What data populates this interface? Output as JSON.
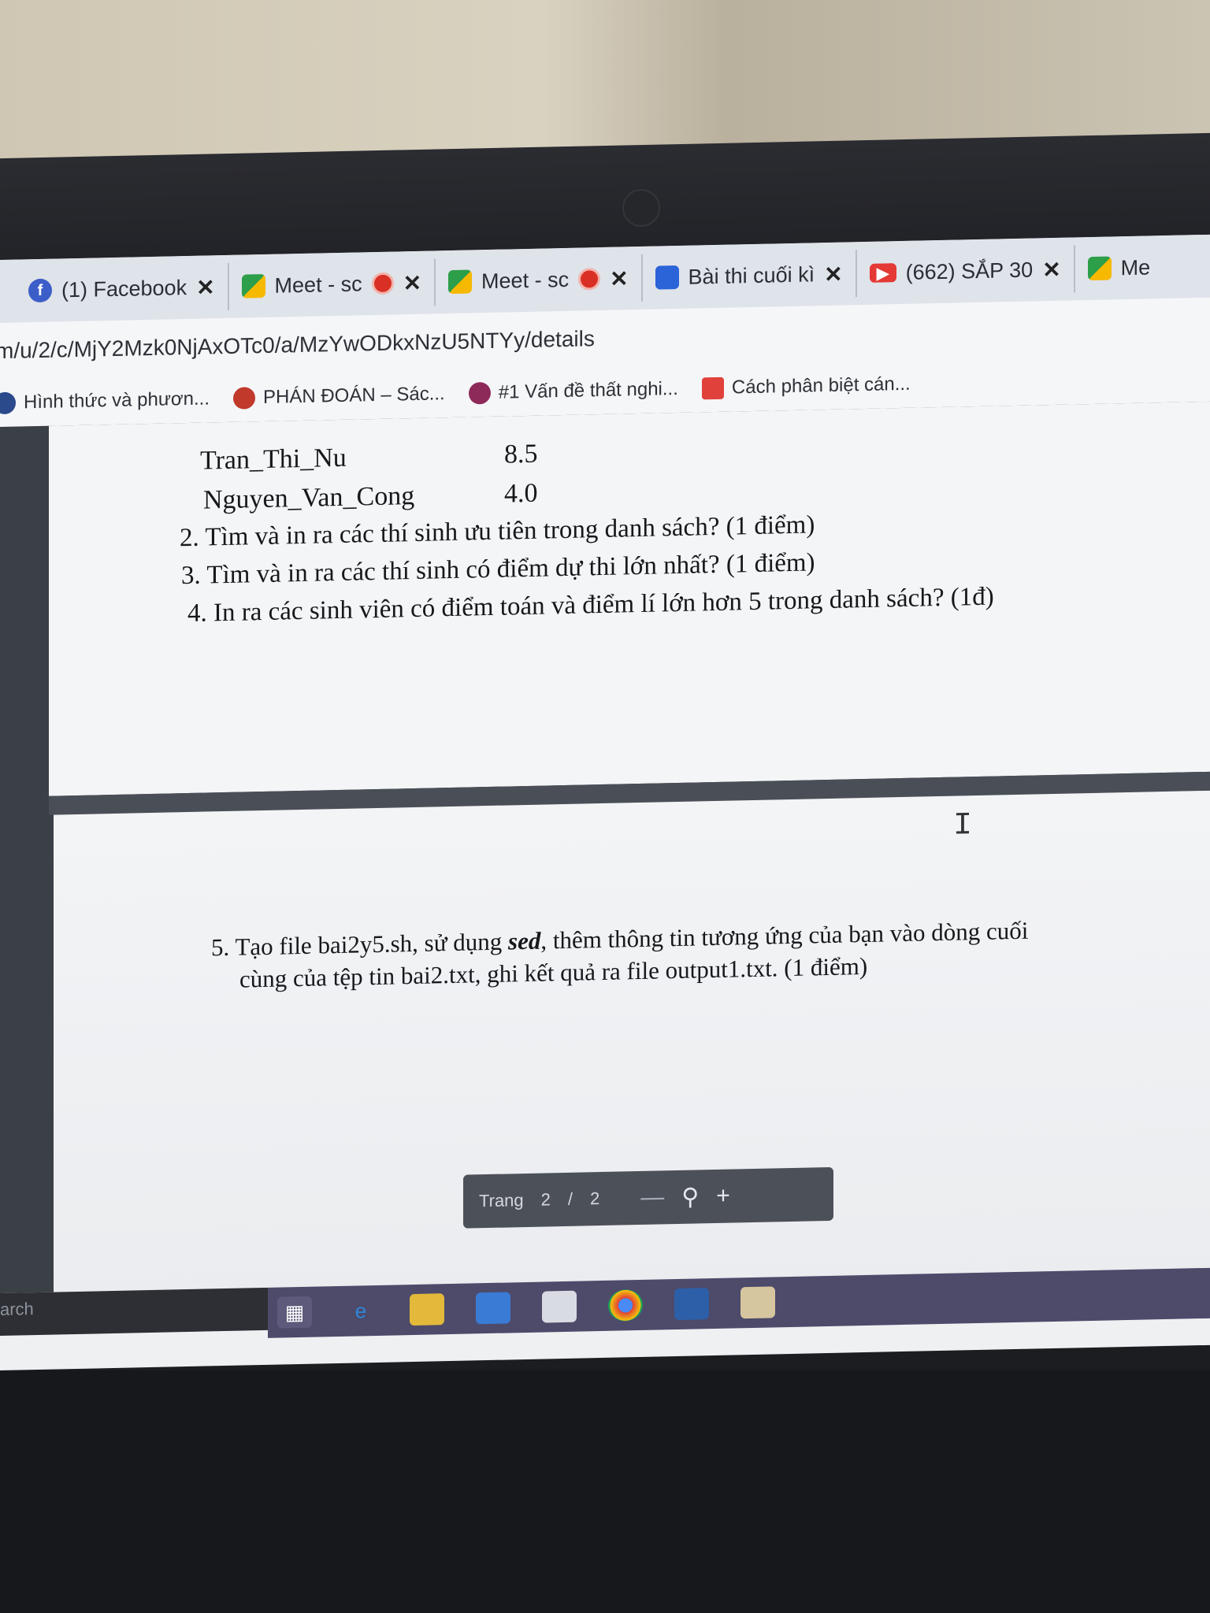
{
  "browser": {
    "tabs": [
      {
        "title": "(1) Facebook",
        "icon": "facebook-icon"
      },
      {
        "title": "Meet - sc",
        "icon": "meet-icon",
        "recording": true
      },
      {
        "title": "Meet - sc",
        "icon": "meet-icon",
        "recording": true
      },
      {
        "title": "Bài thi cuối kì",
        "icon": "classroom-icon"
      },
      {
        "title": "(662) SẮP 30",
        "icon": "youtube-icon"
      },
      {
        "title": "Me",
        "icon": "meet-icon"
      }
    ],
    "close_glyph": "✕",
    "url": "m/u/2/c/MjY2Mzk0NjAxOTc0/a/MzYwODkxNzU5NTYy/details",
    "bookmarks": [
      {
        "label": "Hình thức và phươn...",
        "icon": "bookmark-icon"
      },
      {
        "label": "PHÁN ĐOÁN – Sác...",
        "icon": "bookmark-icon"
      },
      {
        "label": "#1 Vấn đề thất nghi...",
        "icon": "bookmark-icon"
      },
      {
        "label": "Cách phân biệt cán...",
        "icon": "bookmark-icon"
      }
    ]
  },
  "document": {
    "rows": [
      {
        "name": "Tran_Thi_Nu",
        "score": "8.5"
      },
      {
        "name": "Nguyen_Van_Cong",
        "score": "4.0"
      }
    ],
    "questions": [
      "2. Tìm và in ra các thí sinh ưu tiên trong danh sách? (1 điểm)",
      "3. Tìm và in ra các thí sinh có điểm dự thi lớn nhất? (1 điểm)",
      "4. In ra các sinh viên có điểm toán và điểm lí lớn hơn 5 trong danh sách? (1đ)"
    ],
    "q5": {
      "prefix": "5. Tạo file bai2y5.sh, sử dụng ",
      "emphasis": "sed",
      "suffix": ", thêm thông tin tương ứng của bạn vào dòng cuối",
      "line2": "cùng của tệp tin bai2.txt, ghi kết quả ra file output1.txt. (1 điểm)"
    }
  },
  "pager": {
    "label": "Trang",
    "current": "2",
    "separator": "/",
    "total": "2",
    "zoom_out": "—",
    "zoom_in": "+"
  },
  "taskbar": {
    "search_text": "arch",
    "apps": [
      "task-view-icon",
      "edge-icon",
      "file-explorer-icon",
      "store-icon",
      "mail-icon",
      "chrome-icon",
      "virtualbox-icon",
      "app-icon"
    ]
  },
  "colors": {
    "tab_bg": "#dfe3ea",
    "viewer_bg": "#3b3f46",
    "taskbar_bg": "#4d4a6a"
  }
}
